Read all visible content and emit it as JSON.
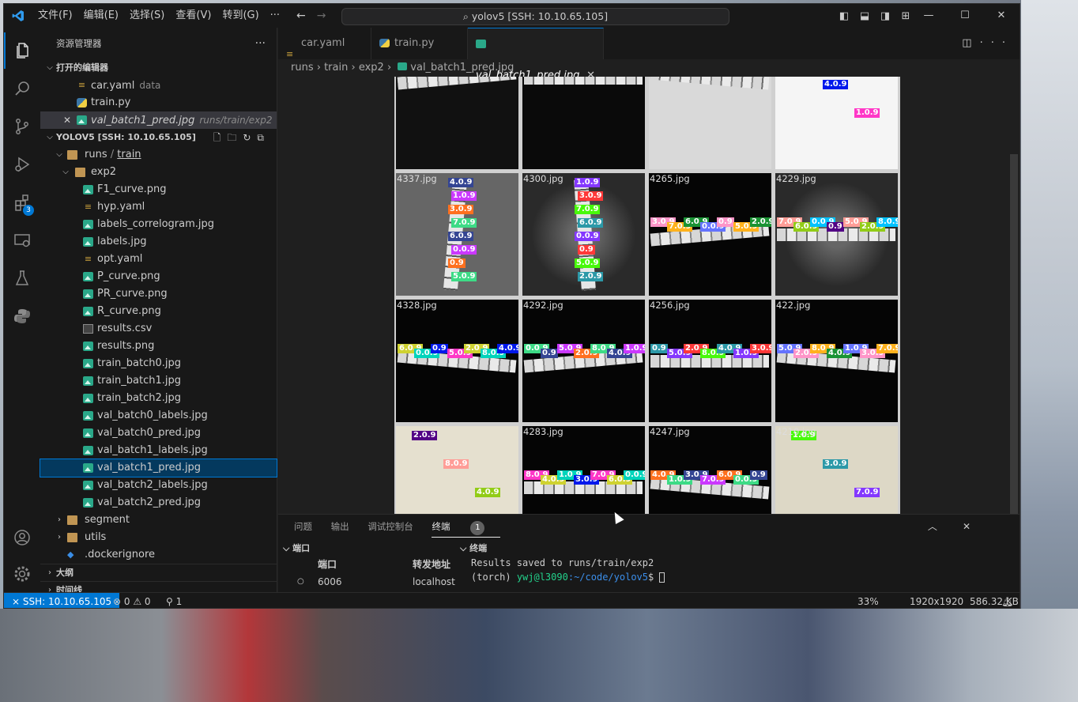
{
  "titlebar": {
    "menus": [
      "文件(F)",
      "编辑(E)",
      "选择(S)",
      "查看(V)",
      "转到(G)",
      "···"
    ],
    "search": "yolov5 [SSH: 10.10.65.105]"
  },
  "sidebar": {
    "title": "资源管理器",
    "open_editors_header": "打开的编辑器",
    "open_editors": [
      {
        "name": "car.yaml",
        "desc": "data"
      },
      {
        "name": "train.py",
        "desc": ""
      },
      {
        "name": "val_batch1_pred.jpg",
        "desc": "runs/train/exp2"
      }
    ],
    "workspace_header": "YOLOV5 [SSH: 10.10.65.105]",
    "tree": {
      "runs": "runs",
      "sep": "/",
      "train": "train",
      "exp2": "exp2",
      "files": [
        "F1_curve.png",
        "hyp.yaml",
        "labels_correlogram.jpg",
        "labels.jpg",
        "opt.yaml",
        "P_curve.png",
        "PR_curve.png",
        "R_curve.png",
        "results.csv",
        "results.png",
        "train_batch0.jpg",
        "train_batch1.jpg",
        "train_batch2.jpg",
        "val_batch0_labels.jpg",
        "val_batch0_pred.jpg",
        "val_batch1_labels.jpg",
        "val_batch1_pred.jpg",
        "val_batch2_labels.jpg",
        "val_batch2_pred.jpg"
      ],
      "segment": "segment",
      "utils": "utils",
      "dockerignore": ".dockerignore"
    },
    "outline": "大纲",
    "timeline": "时间线"
  },
  "tabs": [
    {
      "label": "car.yaml"
    },
    {
      "label": "train.py"
    },
    {
      "label": "val_batch1_pred.jpg"
    }
  ],
  "breadcrumbs": [
    "runs",
    "train",
    "exp2",
    "val_batch1_pred.jpg"
  ],
  "image": {
    "captions": [
      "",
      "",
      "",
      "",
      "4337.jpg",
      "4300.jpg",
      "4265.jpg",
      "4229.jpg",
      "4328.jpg",
      "4292.jpg",
      "4256.jpg",
      "422.jpg",
      "",
      "4283.jpg",
      "4247.jpg",
      "4210.jpg"
    ],
    "labels": [
      "0.9",
      "5.0.9",
      "2.0.9",
      "8.0.9",
      "4.0.9",
      "1.0.9",
      "3.0.9",
      "7.0.9",
      "6.0.9",
      "0.0.9"
    ]
  },
  "panel": {
    "tabs": [
      "问题",
      "输出",
      "调试控制台",
      "终端"
    ],
    "badge": "1",
    "ports_header": "端口",
    "terminal_header": "终端",
    "ports_cols": [
      "端口",
      "转发地址"
    ],
    "port_row": {
      "port": "6006",
      "addr": "localhost"
    },
    "term_line1": "Results saved to runs/train/exp2",
    "term_prompt_env": "(torch)",
    "term_user": "ywj@l3090",
    "term_path": ":~/code/yolov5",
    "term_dollar": "$"
  },
  "status": {
    "remote": "SSH: 10.10.65.105",
    "problems": "0",
    "warnings": "0",
    "ports": "1",
    "zoom": "33%",
    "dims": "1920x1920",
    "size": "586.32 KB"
  },
  "activity_badge": "3",
  "colors": {
    "accent": "#0078d4",
    "selection": "#04395e"
  }
}
